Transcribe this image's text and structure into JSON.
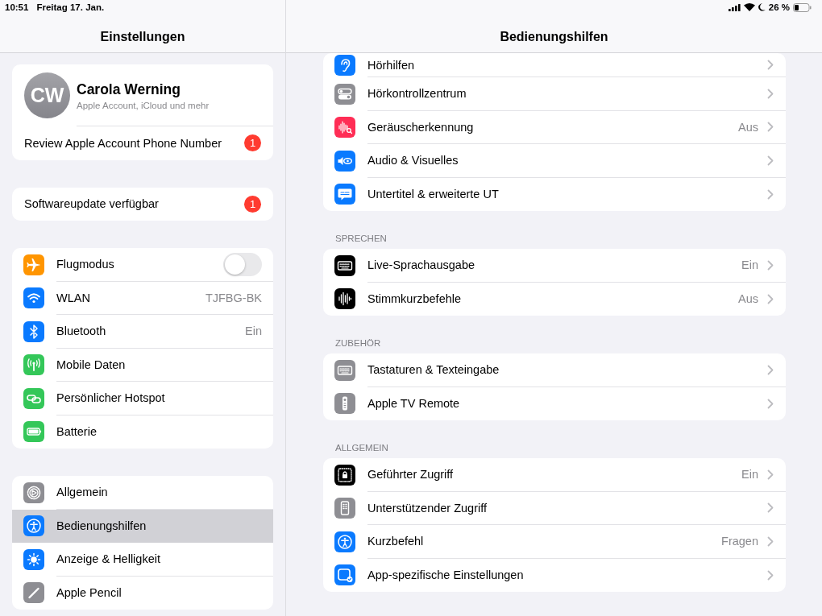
{
  "status_bar": {
    "time": "10:51",
    "date": "Freitag 17. Jan.",
    "battery": "26 %"
  },
  "sidebar": {
    "title": "Einstellungen",
    "account": {
      "initials": "CW",
      "name": "Carola Werning",
      "subtitle": "Apple Account, iCloud und mehr",
      "notice": "Review Apple Account Phone Number",
      "notice_badge": "1"
    },
    "update": {
      "label": "Softwareupdate verfügbar",
      "badge": "1"
    },
    "groups": [
      {
        "items": [
          {
            "label": "Flugmodus",
            "color": "#ff9500",
            "kind": "toggle",
            "on": false,
            "selected": false
          },
          {
            "label": "WLAN",
            "color": "#0a7aff",
            "kind": "link",
            "value": "TJFBG-BK",
            "selected": false
          },
          {
            "label": "Bluetooth",
            "color": "#0a7aff",
            "kind": "link",
            "value": "Ein",
            "selected": false
          },
          {
            "label": "Mobile Daten",
            "color": "#34c759",
            "kind": "link",
            "selected": false
          },
          {
            "label": "Persönlicher Hotspot",
            "color": "#34c759",
            "kind": "link",
            "selected": false
          },
          {
            "label": "Batterie",
            "color": "#34c759",
            "kind": "link",
            "selected": false
          }
        ]
      },
      {
        "items": [
          {
            "label": "Allgemein",
            "color": "#8e8e93",
            "kind": "link",
            "selected": false
          },
          {
            "label": "Bedienungshilfen",
            "color": "#0a7aff",
            "kind": "link",
            "selected": true
          },
          {
            "label": "Anzeige & Helligkeit",
            "color": "#0a7aff",
            "kind": "link",
            "selected": false
          },
          {
            "label": "Apple Pencil",
            "color": "#8e8e93",
            "kind": "link",
            "selected": false
          }
        ]
      }
    ]
  },
  "detail": {
    "title": "Bedienungshilfen",
    "sections": [
      {
        "items": [
          {
            "label": "Hörhilfen",
            "color": "#0a7aff"
          },
          {
            "label": "Hörkontrollzentrum",
            "color": "#8e8e93"
          },
          {
            "label": "Geräuscherkennung",
            "color": "#ff2d55",
            "value": "Aus"
          },
          {
            "label": "Audio & Visuelles",
            "color": "#0a7aff"
          },
          {
            "label": "Untertitel & erweiterte UT",
            "color": "#0a7aff"
          }
        ]
      },
      {
        "header": "SPRECHEN",
        "items": [
          {
            "label": "Live-Sprachausgabe",
            "color": "#000000",
            "value": "Ein"
          },
          {
            "label": "Stimmkurzbefehle",
            "color": "#000000",
            "value": "Aus"
          }
        ]
      },
      {
        "header": "ZUBEHÖR",
        "items": [
          {
            "label": "Tastaturen & Texteingabe",
            "color": "#8e8e93"
          },
          {
            "label": "Apple TV Remote",
            "color": "#8e8e93"
          }
        ]
      },
      {
        "header": "ALLGEMEIN",
        "items": [
          {
            "label": "Geführter Zugriff",
            "color": "#000000",
            "value": "Ein"
          },
          {
            "label": "Unterstützender Zugriff",
            "color": "#8e8e93"
          },
          {
            "label": "Kurzbefehl",
            "color": "#0a7aff",
            "value": "Fragen"
          },
          {
            "label": "App-spezifische Einstellungen",
            "color": "#0a7aff"
          }
        ]
      }
    ]
  }
}
